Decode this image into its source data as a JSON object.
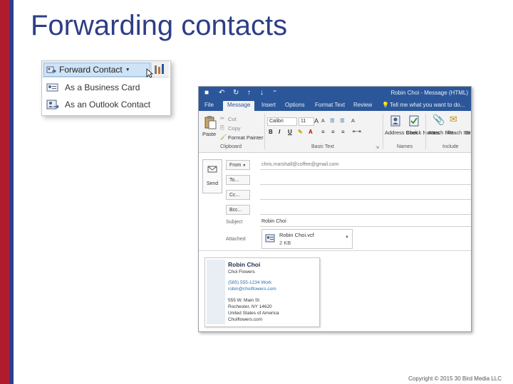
{
  "slide": {
    "title": "Forwarding contacts",
    "copyright": "Copyright © 2015 30 Bird Media LLC",
    "colors": {
      "stripe_red": "#b01c2e",
      "stripe_blue": "#2a3f8f",
      "title": "#2e3e86"
    }
  },
  "forward_menu": {
    "button_label": "Forward Contact",
    "button_icon": "forward-contact-icon",
    "items": [
      {
        "label": "As a Business Card",
        "icon": "business-card-icon"
      },
      {
        "label": "As an Outlook Contact",
        "icon": "outlook-contact-icon"
      }
    ]
  },
  "outlook": {
    "window_title": "Robin Choi - Message (HTML)",
    "tabs": [
      "File",
      "Message",
      "Insert",
      "Options",
      "Format Text",
      "Review"
    ],
    "active_tab": "Message",
    "tell_me": "Tell me what you want to do...",
    "ribbon": {
      "paste": "Paste",
      "cut": "Cut",
      "copy": "Copy",
      "format_painter": "Format Painter",
      "font_name": "Calibri",
      "font_size": "11",
      "clipboard_group": "Clipboard",
      "basic_text_group": "Basic Text",
      "address_book": "Address Book",
      "check_names": "Check Names",
      "names_group": "Names",
      "attach_file": "Attach File",
      "attach_item": "Attach Item",
      "signature_partial": "Si",
      "include_group": "Include"
    },
    "compose": {
      "send": "Send",
      "from_label": "From",
      "from_value": "chris.marshall@coffee@gmail.com",
      "to_label": "To...",
      "cc_label": "Cc...",
      "bcc_label": "Bcc...",
      "subject_label": "Subject",
      "subject_value": "Robin Choi",
      "attached_label": "Attached",
      "attachment_name": "Robin Choi.vcf",
      "attachment_size": "2 KB"
    },
    "card": {
      "name": "Robin Choi",
      "company": "Choi Flowers",
      "phone": "(585) 555-1234 Work",
      "email": "robin@choiflowers.com",
      "street": "555 W. Main St",
      "city": "Rochester, NY 14620",
      "country": "United States of America",
      "web": "Choiflowers.com"
    }
  }
}
